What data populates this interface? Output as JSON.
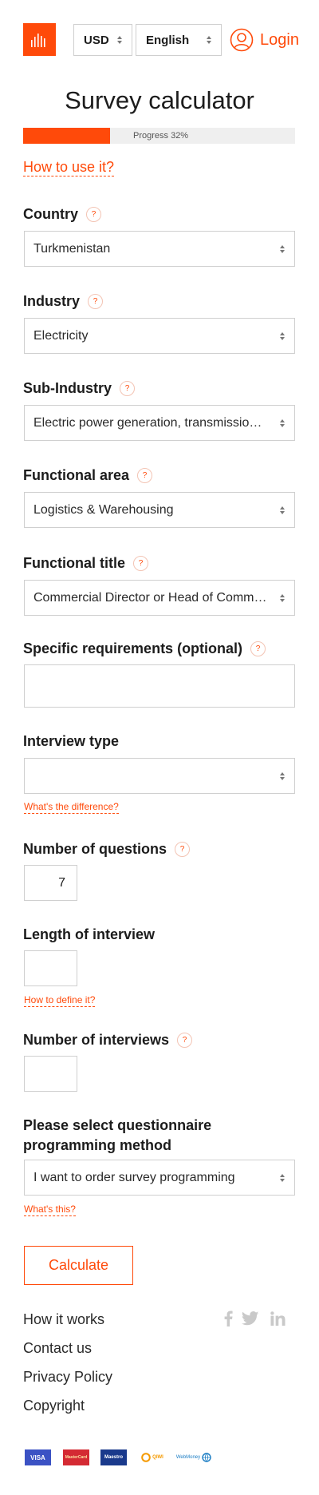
{
  "header": {
    "currency": "USD",
    "language": "English",
    "login_label": "Login"
  },
  "page_title": "Survey calculator",
  "progress": {
    "value_percent": 32,
    "label": "Progress 32%"
  },
  "how_to_use": "How to use it?",
  "form": {
    "country": {
      "label": "Country",
      "help": "?",
      "value": "Turkmenistan"
    },
    "industry": {
      "label": "Industry",
      "help": "?",
      "value": "Electricity"
    },
    "sub_industry": {
      "label": "Sub-Industry",
      "help": "?",
      "value": "Electric power generation, transmission and distribution"
    },
    "functional_area": {
      "label": "Functional area",
      "help": "?",
      "value": "Logistics & Warehousing"
    },
    "functional_title": {
      "label": "Functional title",
      "help": "?",
      "value": "Commercial Director or Head of Commercial"
    },
    "specific_requirements": {
      "label": "Specific requirements (optional)",
      "help": "?",
      "value": ""
    },
    "interview_type": {
      "label": "Interview type",
      "value": "",
      "link": "What's the difference?"
    },
    "number_of_questions": {
      "label": "Number of questions",
      "help": "?",
      "value": "7"
    },
    "length_of_interview": {
      "label": "Length of interview",
      "value": "",
      "link": "How to define it?"
    },
    "number_of_interviews": {
      "label": "Number of interviews",
      "help": "?",
      "value": ""
    },
    "programming_method": {
      "label_line1": "Please select questionnaire",
      "label_line2": "programming method",
      "value": "I want to order survey programming",
      "link": "What's this?"
    },
    "calculate_label": "Calculate"
  },
  "footer": {
    "links": [
      "How it works",
      "Contact us",
      "Privacy Policy",
      "Copyright"
    ],
    "social_icons": [
      "facebook-icon",
      "twitter-icon",
      "linkedin-icon"
    ],
    "payments": [
      "VISA",
      "MasterCard",
      "Maestro",
      "QIWI",
      "WebMoney"
    ]
  },
  "colors": {
    "accent": "#ff4a0a",
    "border": "#cfcfcf",
    "progress_track": "#efefef",
    "social_gray": "#c9c9c9"
  }
}
